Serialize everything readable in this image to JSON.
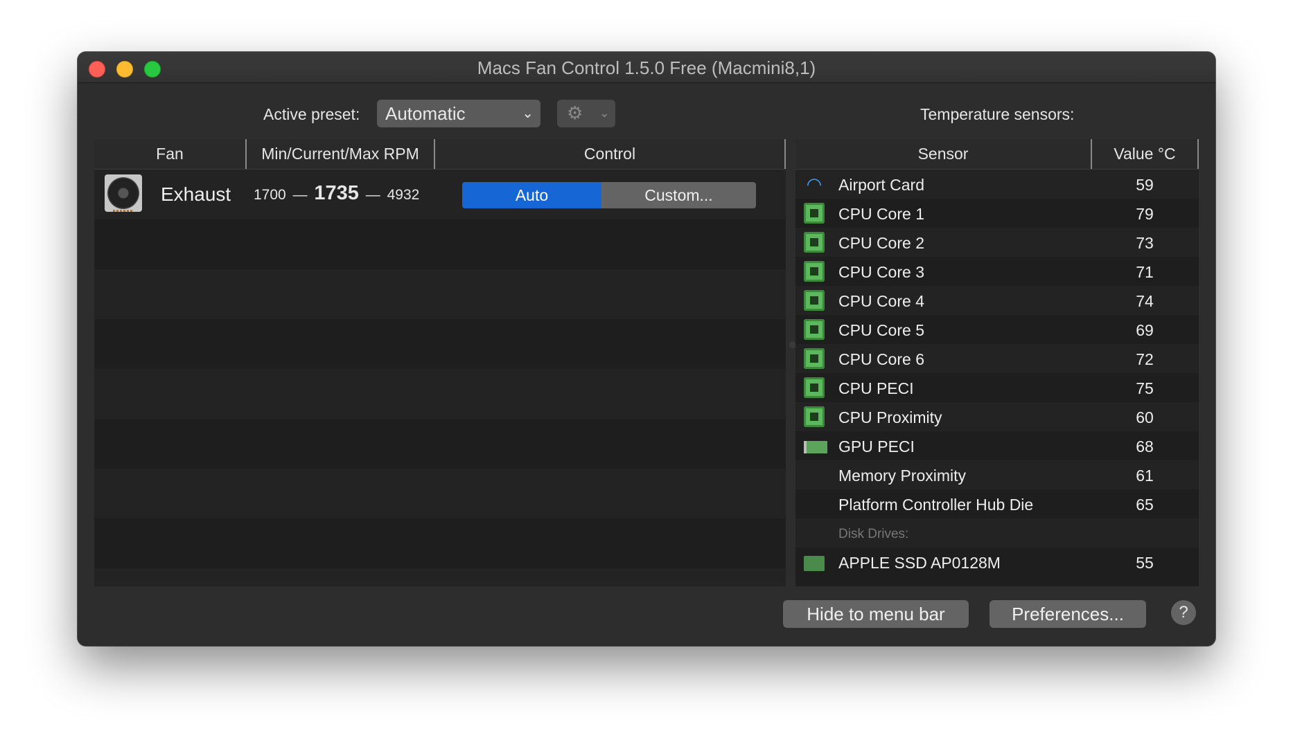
{
  "window": {
    "title": "Macs Fan Control 1.5.0 Free (Macmini8,1)"
  },
  "toolbar": {
    "preset_label": "Active preset:",
    "preset_value": "Automatic",
    "sensors_title": "Temperature sensors:"
  },
  "fan_table": {
    "headers": {
      "fan": "Fan",
      "rpm": "Min/Current/Max RPM",
      "control": "Control"
    },
    "rows": [
      {
        "name": "Exhaust",
        "min": "1700",
        "current": "1735",
        "max": "4932",
        "sep": "—",
        "control_auto": "Auto",
        "control_custom": "Custom...",
        "selected": "Auto"
      }
    ]
  },
  "sensor_table": {
    "headers": {
      "sensor": "Sensor",
      "value": "Value °C"
    },
    "rows": [
      {
        "icon": "wifi-icon",
        "name": "Airport Card",
        "value": "59"
      },
      {
        "icon": "cpu-chip-icon",
        "name": "CPU Core 1",
        "value": "79"
      },
      {
        "icon": "cpu-chip-icon",
        "name": "CPU Core 2",
        "value": "73"
      },
      {
        "icon": "cpu-chip-icon",
        "name": "CPU Core 3",
        "value": "71"
      },
      {
        "icon": "cpu-chip-icon",
        "name": "CPU Core 4",
        "value": "74"
      },
      {
        "icon": "cpu-chip-icon",
        "name": "CPU Core 5",
        "value": "69"
      },
      {
        "icon": "cpu-chip-icon",
        "name": "CPU Core 6",
        "value": "72"
      },
      {
        "icon": "cpu-chip-icon",
        "name": "CPU PECI",
        "value": "75"
      },
      {
        "icon": "cpu-chip-icon",
        "name": "CPU Proximity",
        "value": "60"
      },
      {
        "icon": "gpu-card-icon",
        "name": "GPU PECI",
        "value": "68"
      },
      {
        "icon": "",
        "name": "Memory Proximity",
        "value": "61"
      },
      {
        "icon": "",
        "name": "Platform Controller Hub Die",
        "value": "65"
      }
    ],
    "section": "Disk Drives:",
    "disk_rows": [
      {
        "icon": "ssd-icon",
        "name": "APPLE SSD AP0128M",
        "value": "55"
      }
    ]
  },
  "footer": {
    "hide_label": "Hide to menu bar",
    "prefs_label": "Preferences...",
    "help_label": "?"
  },
  "colors": {
    "accent": "#1666d6",
    "window_bg": "#2d2d2d",
    "table_bg": "#1e1e1e",
    "button_bg": "#646464"
  }
}
